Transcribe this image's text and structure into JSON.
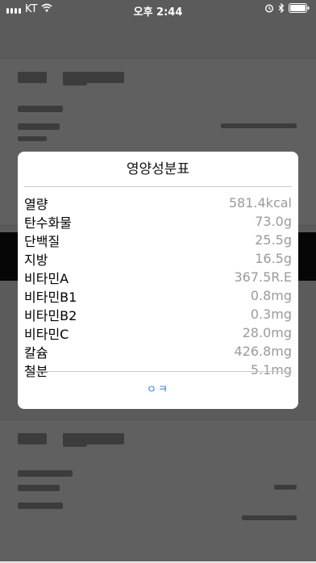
{
  "status_bar": {
    "carrier": "KT",
    "time": "오후 2:44",
    "icons": [
      "signal-icon",
      "wifi-icon",
      "alarm-icon",
      "bluetooth-icon",
      "battery-icon"
    ]
  },
  "dialog": {
    "title": "영양성분표",
    "ok_label": "ㅇㅋ",
    "nutrients": [
      {
        "name": "열량",
        "value": "581.4kcal"
      },
      {
        "name": "탄수화물",
        "value": "73.0g"
      },
      {
        "name": "단백질",
        "value": "25.5g"
      },
      {
        "name": "지방",
        "value": "16.5g"
      },
      {
        "name": "비타민A",
        "value": "367.5R.E"
      },
      {
        "name": "비타민B1",
        "value": "0.8mg"
      },
      {
        "name": "비타민B2",
        "value": "0.3mg"
      },
      {
        "name": "비타민C",
        "value": "28.0mg"
      },
      {
        "name": "칼슘",
        "value": "426.8mg"
      },
      {
        "name": "철분",
        "value": "5.1mg"
      }
    ]
  },
  "colors": {
    "accent": "#2a7ae2",
    "value_text": "#9a9a9a",
    "overlay": "rgba(0,0,0,0.62)"
  }
}
